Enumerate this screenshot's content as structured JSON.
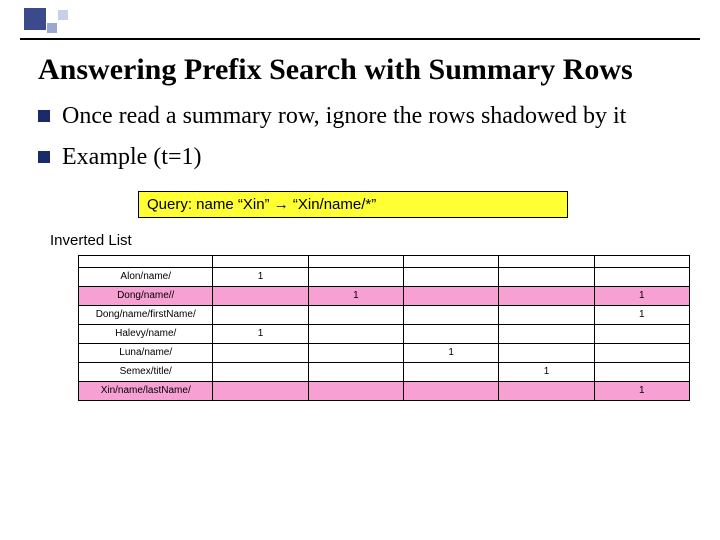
{
  "title": "Answering Prefix Search with Summary Rows",
  "bullets": [
    "Once read a summary row, ignore the rows shadowed by it",
    "Example (t=1)"
  ],
  "query_label": "Query: name “Xin” → “Xin/name/*”",
  "inverted_label": "Inverted List",
  "table": {
    "rows": [
      {
        "key": "Alon/name/",
        "cells": [
          "1",
          "",
          "",
          "",
          ""
        ],
        "highlight": false
      },
      {
        "key": "Dong/name//",
        "cells": [
          "",
          "1",
          "",
          "",
          "1"
        ],
        "highlight": true
      },
      {
        "key": "Dong/name/firstName/",
        "cells": [
          "",
          "",
          "",
          "",
          "1"
        ],
        "highlight": false
      },
      {
        "key": "Halevy/name/",
        "cells": [
          "1",
          "",
          "",
          "",
          ""
        ],
        "highlight": false
      },
      {
        "key": "Luna/name/",
        "cells": [
          "",
          "",
          "1",
          "",
          ""
        ],
        "highlight": false
      },
      {
        "key": "Semex/title/",
        "cells": [
          "",
          "",
          "",
          "1",
          ""
        ],
        "highlight": false
      },
      {
        "key": "Xin/name/lastName/",
        "cells": [
          "",
          "",
          "",
          "",
          "1"
        ],
        "highlight": true
      }
    ]
  }
}
